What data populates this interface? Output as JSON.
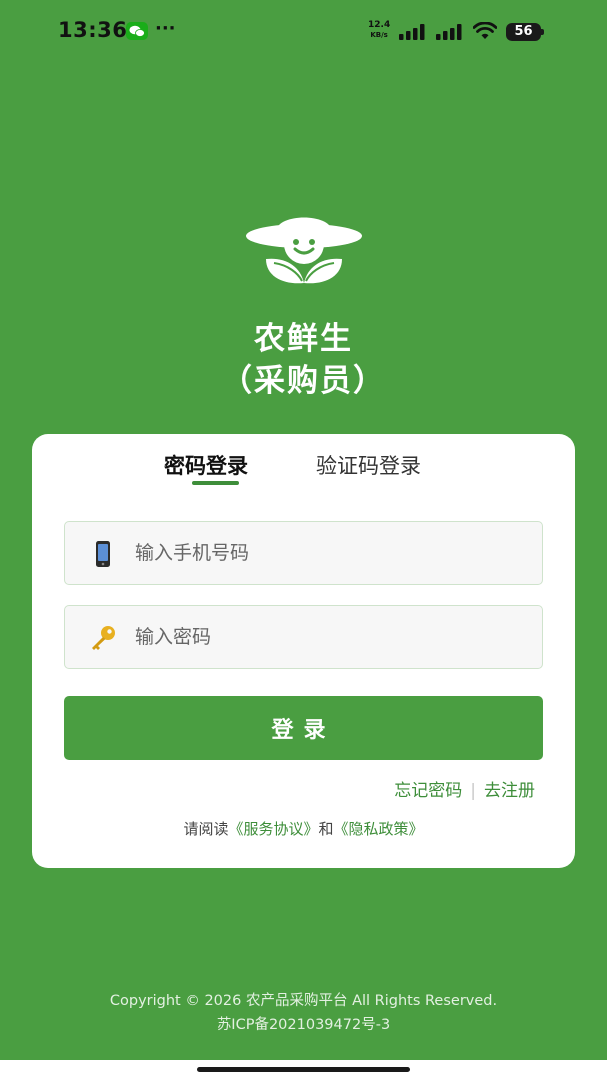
{
  "status_bar": {
    "time": "13:36",
    "more": "···",
    "net_speed_value": "12.4",
    "net_speed_unit": "KB/s",
    "battery_level": "56",
    "battery_percent": 56,
    "wechat_icon": "wechat-icon",
    "signal_icon": "signal-bars-icon",
    "wifi_icon": "wifi-icon"
  },
  "header": {
    "logo_icon": "farmer-hat-leaf-logo",
    "title": "农鲜生",
    "subtitle": "（采购员）"
  },
  "tabs": [
    {
      "label": "密码登录",
      "active": true
    },
    {
      "label": "验证码登录",
      "active": false
    }
  ],
  "form": {
    "phone": {
      "icon": "mobile-phone-icon",
      "placeholder": "输入手机号码",
      "value": ""
    },
    "password": {
      "icon": "key-icon",
      "placeholder": "输入密码",
      "value": ""
    },
    "login_label": "登录"
  },
  "links": {
    "forgot_password": "忘记密码",
    "separator": "|",
    "register": "去注册"
  },
  "agreement": {
    "prefix": "请阅读",
    "service": "《服务协议》",
    "and": "和",
    "privacy": "《隐私政策》"
  },
  "footer": {
    "copyright": "Copyright © 2026 农产品采购平台 All Rights Reserved.",
    "icp": "苏ICP备2021039472号-3"
  },
  "colors": {
    "brand": "#4a9e41",
    "accent_text": "#3e8e3a",
    "card": "#ffffff"
  }
}
